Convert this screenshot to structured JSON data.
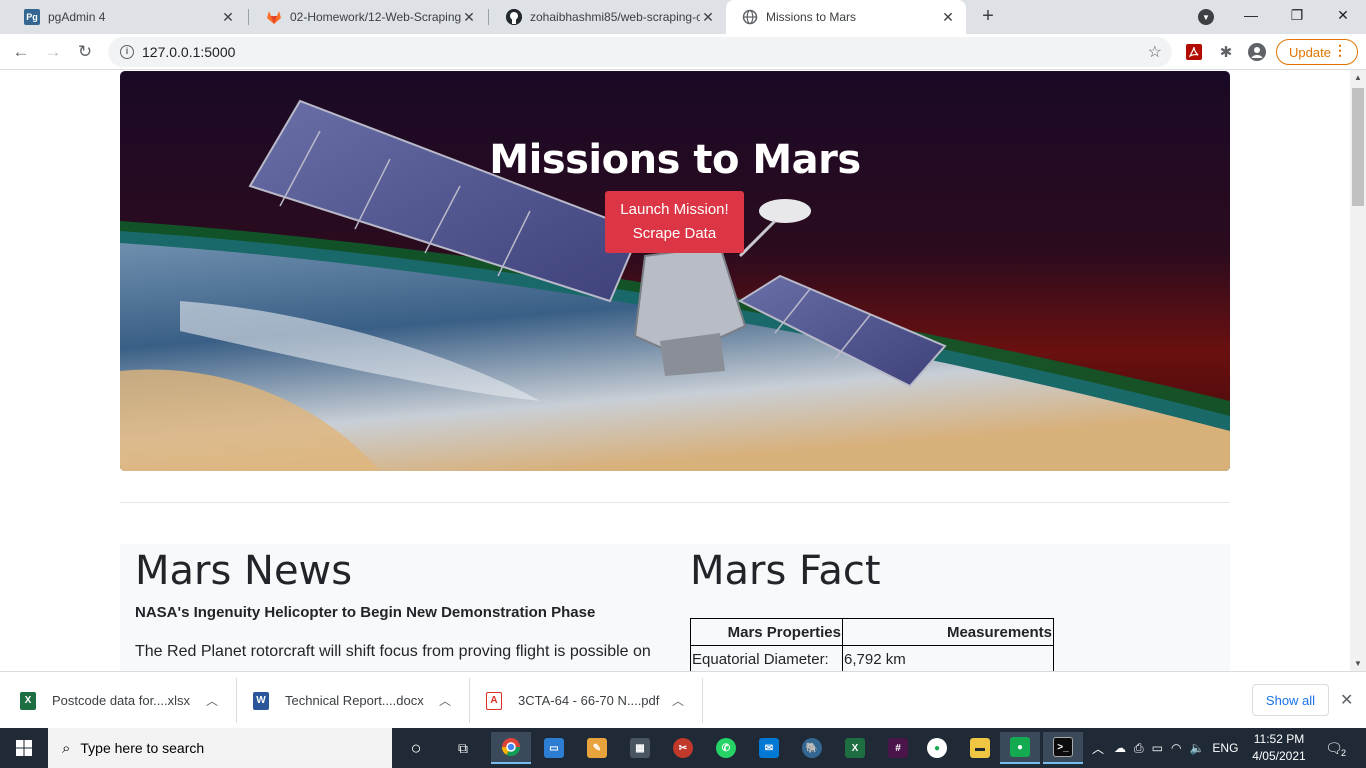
{
  "browser": {
    "tabs": [
      {
        "title": "pgAdmin 4",
        "icon": "pgadmin-icon",
        "active": false
      },
      {
        "title": "02-Homework/12-Web-Scraping",
        "icon": "gitlab-icon",
        "active": false
      },
      {
        "title": "zohaibhashmi85/web-scraping-c",
        "icon": "github-icon",
        "active": false
      },
      {
        "title": "Missions to Mars",
        "icon": "globe-icon",
        "active": true
      }
    ],
    "url": "127.0.0.1:5000",
    "update_label": "Update"
  },
  "page": {
    "hero_title": "Missions to Mars",
    "launch_button_line1": "Launch Mission!",
    "launch_button_line2": "Scrape Data",
    "news": {
      "heading": "Mars News",
      "title": "NASA's Ingenuity Helicopter to Begin New Demonstration Phase",
      "paragraph": "The Red Planet rotorcraft will shift focus from proving flight is possible on"
    },
    "facts": {
      "heading": "Mars Fact",
      "col1_header": "Mars Properties",
      "col2_header": "Measurements",
      "rows": [
        {
          "property": "Equatorial Diameter:",
          "value": "6,792 km"
        }
      ]
    }
  },
  "downloads": {
    "items": [
      {
        "name": "Postcode data for....xlsx",
        "icon": "excel-file-icon",
        "color": "#1d6f42"
      },
      {
        "name": "Technical Report....docx",
        "icon": "word-file-icon",
        "color": "#2b579a"
      },
      {
        "name": "3CTA-64 - 66-70 N....pdf",
        "icon": "pdf-file-icon",
        "color": "#d93025"
      }
    ],
    "show_all": "Show all"
  },
  "taskbar": {
    "search_placeholder": "Type here to search",
    "language": "ENG",
    "time": "11:52 PM",
    "date": "4/05/2021",
    "notification_count": "2"
  },
  "colors": {
    "launch_button": "#dc3545",
    "update_accent": "#e37400",
    "taskbar": "#1f2a36"
  }
}
